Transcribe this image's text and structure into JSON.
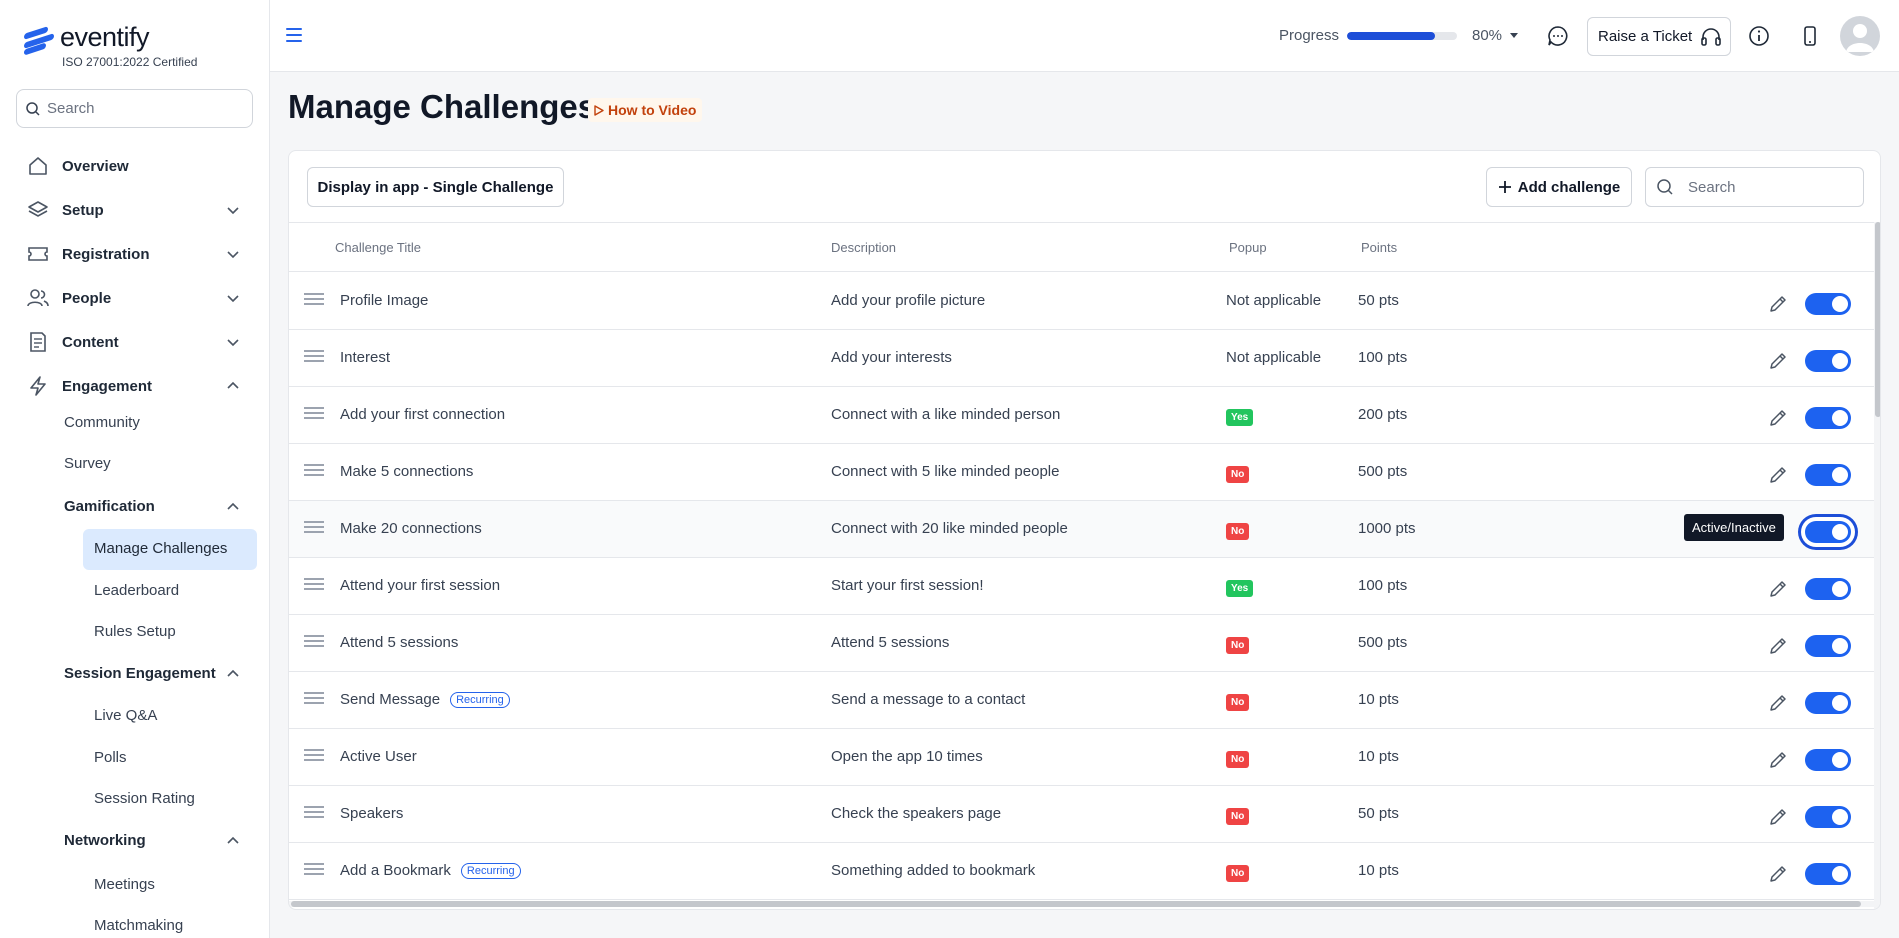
{
  "brand": {
    "name": "eventify",
    "certification": "ISO 27001:2022 Certified"
  },
  "sidebar": {
    "search_placeholder": "Search",
    "items": [
      {
        "label": "Overview",
        "icon": "home-icon"
      },
      {
        "label": "Setup",
        "icon": "layers-icon"
      },
      {
        "label": "Registration",
        "icon": "ticket-icon"
      },
      {
        "label": "People",
        "icon": "people-icon"
      },
      {
        "label": "Content",
        "icon": "document-icon"
      },
      {
        "label": "Engagement",
        "icon": "lightning-icon"
      }
    ],
    "engagement": {
      "community": "Community",
      "survey": "Survey",
      "gamification": "Gamification",
      "manage_challenges": "Manage Challenges",
      "leaderboard": "Leaderboard",
      "rules_setup": "Rules Setup",
      "session_engagement": "Session Engagement",
      "live_qa": "Live Q&A",
      "polls": "Polls",
      "session_rating": "Session Rating",
      "networking": "Networking",
      "meetings": "Meetings",
      "matchmaking": "Matchmaking"
    }
  },
  "topbar": {
    "progress_label": "Progress",
    "progress_value": 0.8,
    "progress_text": "80%",
    "raise_ticket": "Raise a Ticket"
  },
  "page": {
    "title": "Manage Challenges",
    "how_to": "How to Video"
  },
  "toolbar": {
    "display_mode": "Display in app - Single Challenge",
    "add_challenge": "Add challenge",
    "search_placeholder": "Search"
  },
  "table": {
    "columns": {
      "title": "Challenge Title",
      "description": "Description",
      "popup": "Popup",
      "points": "Points"
    },
    "tooltip": "Active/Inactive",
    "recurring_label": "Recurring",
    "rows": [
      {
        "title": "Profile Image",
        "description": "Add your profile picture",
        "popup": "Not applicable",
        "points": "50 pts"
      },
      {
        "title": "Interest",
        "description": "Add your interests",
        "popup": "Not applicable",
        "points": "100 pts"
      },
      {
        "title": "Add your first connection",
        "description": "Connect with a like minded person",
        "popup": "Yes",
        "points": "200 pts"
      },
      {
        "title": "Make 5 connections",
        "description": "Connect with 5 like minded people",
        "popup": "No",
        "points": "500 pts"
      },
      {
        "title": "Make 20 connections",
        "description": "Connect with 20 like minded people",
        "popup": "No",
        "points": "1000 pts"
      },
      {
        "title": "Attend your first session",
        "description": "Start your first session!",
        "popup": "Yes",
        "points": "100 pts"
      },
      {
        "title": "Attend 5 sessions",
        "description": "Attend 5 sessions",
        "popup": "No",
        "points": "500 pts"
      },
      {
        "title": "Send Message",
        "description": "Send a message to a contact",
        "popup": "No",
        "points": "10 pts"
      },
      {
        "title": "Active User",
        "description": "Open the app 10 times",
        "popup": "No",
        "points": "10 pts"
      },
      {
        "title": "Speakers",
        "description": "Check the speakers page",
        "popup": "No",
        "points": "50 pts"
      },
      {
        "title": "Add a Bookmark",
        "description": "Something added to bookmark",
        "popup": "No",
        "points": "10 pts"
      }
    ]
  },
  "colors": {
    "accent": "#1d62f0",
    "yes": "#22c55e",
    "no": "#ef4444",
    "how_to": "#c2410c"
  }
}
